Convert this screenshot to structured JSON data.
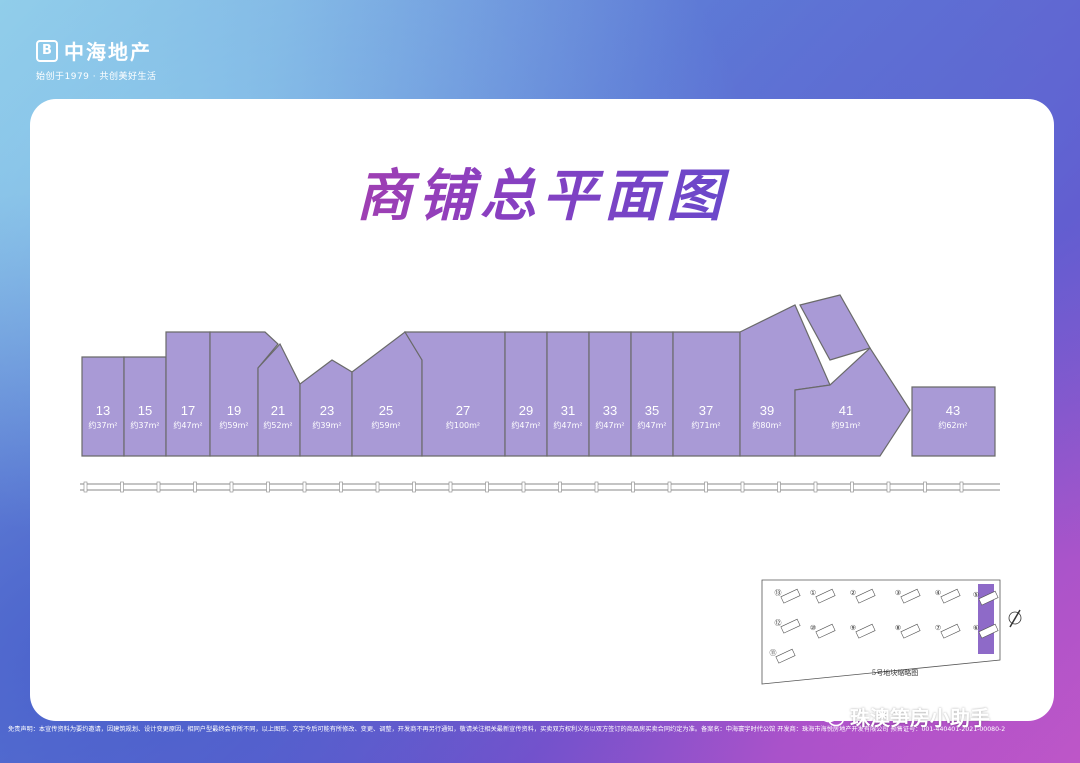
{
  "brand": {
    "mark": "B",
    "name": "中海地产",
    "tagline": "始创于1979 · 共创美好生活"
  },
  "page_title": "商铺总平面图",
  "units": [
    {
      "no": "13",
      "area": "约37m²"
    },
    {
      "no": "15",
      "area": "约37m²"
    },
    {
      "no": "17",
      "area": "约47m²"
    },
    {
      "no": "19",
      "area": "约59m²"
    },
    {
      "no": "21",
      "area": "约52m²"
    },
    {
      "no": "23",
      "area": "约39m²"
    },
    {
      "no": "25",
      "area": "约59m²"
    },
    {
      "no": "27",
      "area": "约100m²"
    },
    {
      "no": "29",
      "area": "约47m²"
    },
    {
      "no": "31",
      "area": "约47m²"
    },
    {
      "no": "33",
      "area": "约47m²"
    },
    {
      "no": "35",
      "area": "约47m²"
    },
    {
      "no": "37",
      "area": "约71m²"
    },
    {
      "no": "39",
      "area": "约80m²"
    },
    {
      "no": "41",
      "area": "约91m²"
    },
    {
      "no": "43",
      "area": "约62m²"
    }
  ],
  "site_map": {
    "caption": "5号地块缩略图",
    "building_labels": [
      "⑬",
      "①",
      "②",
      "③",
      "④",
      "⑤",
      "⑫",
      "⑩",
      "⑨",
      "⑧",
      "⑦",
      "⑥",
      "⑪"
    ]
  },
  "disclaimer": "免责声明：本宣传资料为要约邀请，因建筑规划、设计变更原因，相同户型最终会有所不同，以上图形、文字今后可能有所修改、变更、调整，开发商不再另行通知，敬请关注相关最新宣传资料，买卖双方权利义务以双方签订的商品房买卖合同约定为准。备案名：中海寰宇时代公馆 开发商：珠海市海悦房地产开发有限公司 预售证号：001-440401-2021-00080-2",
  "watermark": "珠澳笋房小助手",
  "colors": {
    "unit_fill": "#a99ad6",
    "unit_stroke": "#6a6a6a",
    "highlight": "#8e6ac8"
  }
}
